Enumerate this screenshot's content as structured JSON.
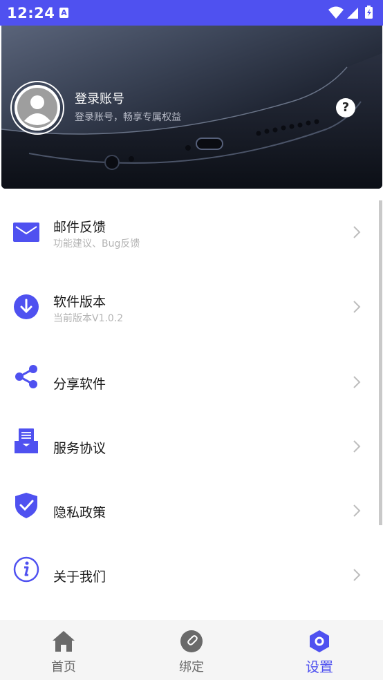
{
  "status_bar": {
    "time": "12:24",
    "notification_letter": "A"
  },
  "header": {
    "title": "登录账号",
    "subtitle": "登录账号，畅享专属权益",
    "help_symbol": "?"
  },
  "menu": [
    {
      "label": "邮件反馈",
      "sub": "功能建议、Bug反馈",
      "icon": "mail-icon"
    },
    {
      "label": "软件版本",
      "sub": "当前版本V1.0.2",
      "icon": "download-icon"
    },
    {
      "label": "分享软件",
      "sub": "",
      "icon": "share-icon"
    },
    {
      "label": "服务协议",
      "sub": "",
      "icon": "agreement-icon"
    },
    {
      "label": "隐私政策",
      "sub": "",
      "icon": "shield-check-icon"
    },
    {
      "label": "关于我们",
      "sub": "",
      "icon": "info-icon"
    }
  ],
  "bottom_nav": [
    {
      "label": "首页",
      "icon": "home-icon"
    },
    {
      "label": "绑定",
      "icon": "link-icon"
    },
    {
      "label": "设置",
      "icon": "settings-hex-icon",
      "active": true
    }
  ],
  "colors": {
    "accent": "#4f51f0",
    "chevron": "#bdbdbd",
    "inactive": "#6a6a6a"
  }
}
